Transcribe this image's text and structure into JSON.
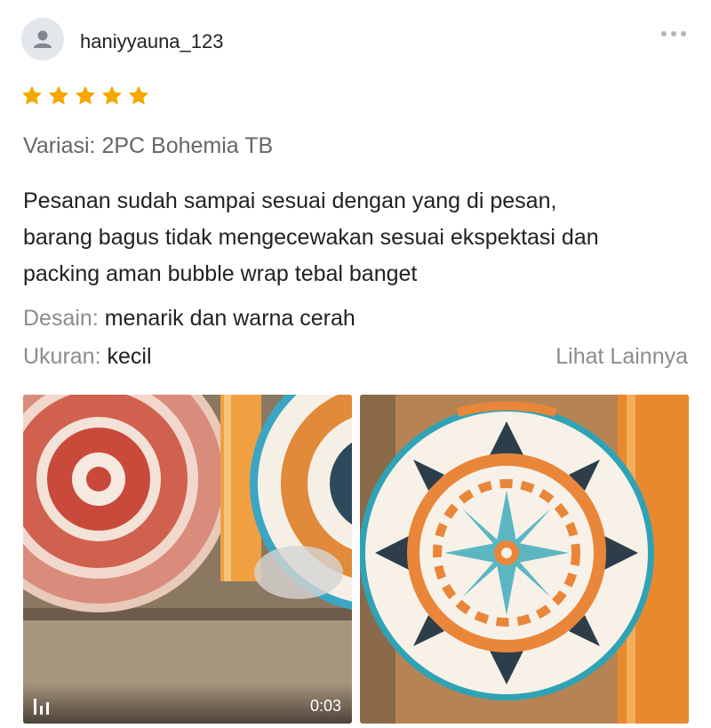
{
  "review": {
    "username": "haniyyauna_123",
    "rating": 5,
    "max_rating": 5,
    "variation": "Variasi: 2PC Bohemia TB",
    "text_lines": [
      "Pesanan sudah sampai sesuai dengan yang di pesan,",
      "barang bagus tidak mengecewakan sesuai ekspektasi dan",
      "packing aman bubble wrap tebal banget"
    ],
    "attributes": [
      {
        "label": "Desain:",
        "value": "menarik dan warna cerah"
      },
      {
        "label": "Ukuran:",
        "value": "kecil"
      }
    ],
    "see_more": "Lihat Lainnya"
  },
  "media": [
    {
      "type": "video",
      "duration": "0:03",
      "icon": "video-bars-icon"
    },
    {
      "type": "photo"
    }
  ],
  "icons": {
    "avatar": "user-icon",
    "more": "more-horizontal-icon",
    "star": "star-icon"
  },
  "colors": {
    "star": "#f6a700",
    "muted_text": "#8c8c8c",
    "body_text": "#222222"
  }
}
